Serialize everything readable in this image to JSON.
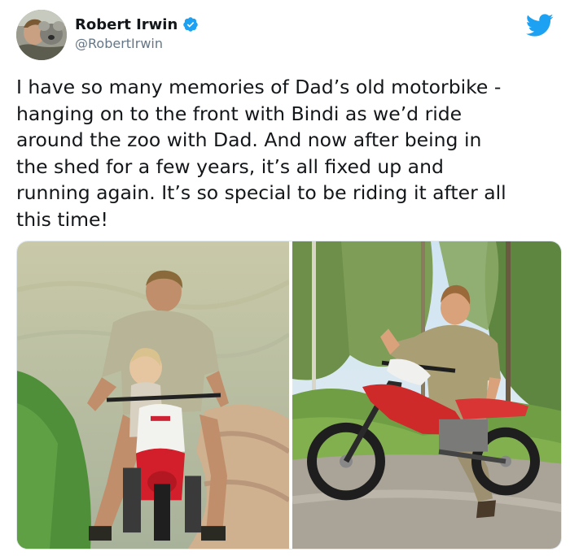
{
  "author": {
    "name": "Robert Irwin",
    "handle": "@RobertIrwin",
    "verified": true,
    "avatar_icon": "profile-avatar"
  },
  "brand": {
    "logo_icon": "twitter-bird-icon",
    "accent": "#1da1f2"
  },
  "tweet": {
    "text_lines": [
      "I have so many memories of Dad’s old motorbike -",
      "hanging on to the front with Bindi as we’d ride",
      "around the zoo with Dad. And now after being in",
      "the shed for a few years, it’s all fixed up and",
      "running again. It’s so special to be riding it after all",
      "this time!"
    ]
  },
  "media": {
    "photos": [
      {
        "subject": "vintage-photo-man-and-child-on-red-dirt-bike"
      },
      {
        "subject": "young-man-on-red-dirt-bike-thumbs-up"
      }
    ]
  },
  "colors": {
    "text": "#14171a",
    "secondary_text": "#657786",
    "verified_blue": "#1da1f2"
  }
}
